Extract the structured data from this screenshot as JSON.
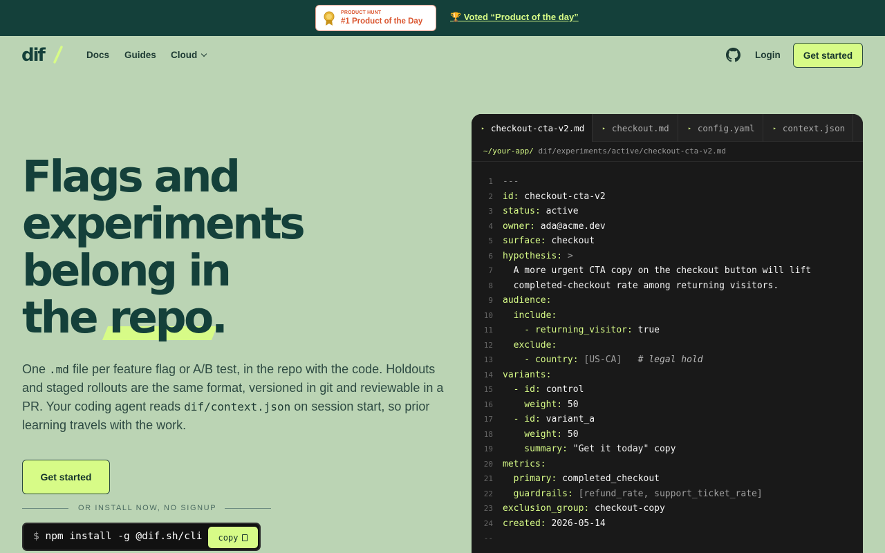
{
  "banner": {
    "badge_small": "PRODUCT HUNT",
    "badge_big": "#1 Product of the Day",
    "voted_text": "🏆 Voted “Product of the day”"
  },
  "nav": {
    "logo_text": "dif",
    "docs": "Docs",
    "guides": "Guides",
    "cloud": "Cloud",
    "login": "Login",
    "get_started": "Get started"
  },
  "hero": {
    "title_line1": "Flags and",
    "title_line2": "experiments",
    "title_line3": "belong in",
    "title_line4a": "the ",
    "title_line4_highlight": "repo",
    "title_line4_end": ".",
    "desc_1": "One ",
    "desc_code1": ".md",
    "desc_2": " file per feature flag or A/B test, in the repo with the code. Holdouts and staged rollouts are the same format, versioned in git and reviewable in a PR. Your coding agent reads ",
    "desc_code2": "dif/context.json",
    "desc_3": " on session start, so prior learning travels with the work.",
    "cta": "Get started",
    "or_text": "OR INSTALL NOW, NO SIGNUP",
    "install_prompt": "$",
    "install_cmd": "npm install -g @dif.sh/cli",
    "copy_label": "copy"
  },
  "editor": {
    "tabs": [
      "checkout-cta-v2.md",
      "checkout.md",
      "config.yaml",
      "context.json"
    ],
    "active_tab": 0,
    "breadcrumb_root": "~/your-app/",
    "breadcrumb_path": " dif/experiments/active/checkout-cta-v2.md",
    "lines": [
      {
        "n": "1",
        "key": "",
        "text": "---"
      },
      {
        "n": "2",
        "key": "id:",
        "text": " checkout-cta-v2"
      },
      {
        "n": "3",
        "key": "status:",
        "text": " active"
      },
      {
        "n": "4",
        "key": "owner:",
        "text": " ada@acme.dev"
      },
      {
        "n": "5",
        "key": "surface:",
        "text": " checkout"
      },
      {
        "n": "6",
        "key": "hypothesis:",
        "text": " >"
      },
      {
        "n": "7",
        "key": "",
        "text": "  A more urgent CTA copy on the checkout button will lift"
      },
      {
        "n": "8",
        "key": "",
        "text": "  completed-checkout rate among returning visitors."
      },
      {
        "n": "9",
        "key": "audience:",
        "text": ""
      },
      {
        "n": "10",
        "key": "  include:",
        "text": ""
      },
      {
        "n": "11",
        "key": "    - returning_visitor:",
        "text": " true"
      },
      {
        "n": "12",
        "key": "  exclude:",
        "text": ""
      },
      {
        "n": "13",
        "key": "    - country:",
        "text": " [US-CA]",
        "comment": "   # legal hold"
      },
      {
        "n": "14",
        "key": "variants:",
        "text": ""
      },
      {
        "n": "15",
        "key": "  - id:",
        "text": " control"
      },
      {
        "n": "16",
        "key": "    weight:",
        "text": " 50"
      },
      {
        "n": "17",
        "key": "  - id:",
        "text": " variant_a"
      },
      {
        "n": "18",
        "key": "    weight:",
        "text": " 50"
      },
      {
        "n": "19",
        "key": "    summary:",
        "text": " \"Get it today\" copy"
      },
      {
        "n": "20",
        "key": "metrics:",
        "text": ""
      },
      {
        "n": "21",
        "key": "  primary:",
        "text": " completed_checkout"
      },
      {
        "n": "22",
        "key": "  guardrails:",
        "text": " [refund_rate, support_ticket_rate]"
      },
      {
        "n": "23",
        "key": "exclusion_group:",
        "text": " checkout-copy"
      },
      {
        "n": "24",
        "key": "created:",
        "text": " 2026-05-14"
      },
      {
        "n": "--",
        "key": "",
        "text": ""
      }
    ]
  },
  "colors": {
    "bg": "#bbd4b4",
    "banner": "#14403a",
    "accent": "#d7fb87",
    "text_dark": "#14403a",
    "editor_bg": "#191919"
  }
}
